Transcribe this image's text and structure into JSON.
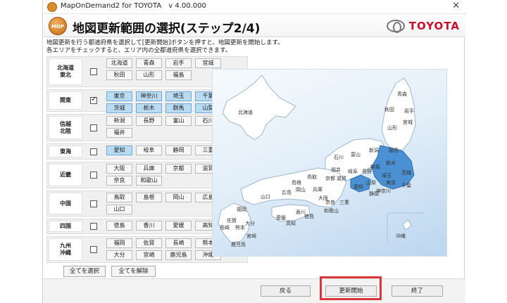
{
  "window": {
    "title": "MapOnDemand2 for TOYOTA",
    "version": "v 4.00.000",
    "close_glyph": "✕"
  },
  "header": {
    "logo_text": "MOP",
    "step_title": "地図更新範囲の選択(ステップ2/4)",
    "brand": "TOYOTA"
  },
  "instructions": {
    "line1": "地図更新を行う都道府県を選択して[更新開始]ボタンを押すと、地図更新を開始します。",
    "line2": "各エリアをチェックすると、エリア内の全都道府県を選択できます。"
  },
  "regions": [
    {
      "label": "北海道\n東北",
      "checked": false,
      "prefs": [
        {
          "name": "北海道",
          "selected": false
        },
        {
          "name": "青森",
          "selected": false
        },
        {
          "name": "岩手",
          "selected": false
        },
        {
          "name": "宮城",
          "selected": false
        },
        {
          "name": "秋田",
          "selected": false
        },
        {
          "name": "山形",
          "selected": false
        },
        {
          "name": "福島",
          "selected": false
        }
      ]
    },
    {
      "label": "関東",
      "checked": true,
      "prefs": [
        {
          "name": "東京",
          "selected": true
        },
        {
          "name": "神奈川",
          "selected": true
        },
        {
          "name": "埼玉",
          "selected": true
        },
        {
          "name": "千葉",
          "selected": true
        },
        {
          "name": "茨城",
          "selected": true
        },
        {
          "name": "栃木",
          "selected": true
        },
        {
          "name": "群馬",
          "selected": true
        },
        {
          "name": "山梨",
          "selected": true
        }
      ]
    },
    {
      "label": "信越\n北陸",
      "checked": false,
      "prefs": [
        {
          "name": "新潟",
          "selected": false
        },
        {
          "name": "長野",
          "selected": false
        },
        {
          "name": "富山",
          "selected": false
        },
        {
          "name": "石川",
          "selected": false
        },
        {
          "name": "福井",
          "selected": false
        }
      ]
    },
    {
      "label": "東海",
      "checked": false,
      "prefs": [
        {
          "name": "愛知",
          "selected": true
        },
        {
          "name": "岐阜",
          "selected": false
        },
        {
          "name": "静岡",
          "selected": false
        },
        {
          "name": "三重",
          "selected": false
        }
      ]
    },
    {
      "label": "近畿",
      "checked": false,
      "prefs": [
        {
          "name": "大阪",
          "selected": false
        },
        {
          "name": "兵庫",
          "selected": false
        },
        {
          "name": "京都",
          "selected": false
        },
        {
          "name": "滋賀",
          "selected": false
        },
        {
          "name": "奈良",
          "selected": false
        },
        {
          "name": "和歌山",
          "selected": false
        }
      ]
    },
    {
      "label": "中国",
      "checked": false,
      "prefs": [
        {
          "name": "鳥取",
          "selected": false
        },
        {
          "name": "島根",
          "selected": false
        },
        {
          "name": "岡山",
          "selected": false
        },
        {
          "name": "広島",
          "selected": false
        },
        {
          "name": "山口",
          "selected": false
        }
      ]
    },
    {
      "label": "四国",
      "checked": false,
      "prefs": [
        {
          "name": "徳島",
          "selected": false
        },
        {
          "name": "香川",
          "selected": false
        },
        {
          "name": "愛媛",
          "selected": false
        },
        {
          "name": "高知",
          "selected": false
        }
      ]
    },
    {
      "label": "九州\n沖縄",
      "checked": false,
      "prefs": [
        {
          "name": "福岡",
          "selected": false
        },
        {
          "name": "佐賀",
          "selected": false
        },
        {
          "name": "長崎",
          "selected": false
        },
        {
          "name": "熊本",
          "selected": false
        },
        {
          "name": "大分",
          "selected": false
        },
        {
          "name": "宮崎",
          "selected": false
        },
        {
          "name": "鹿児島",
          "selected": false
        },
        {
          "name": "沖縄",
          "selected": false
        }
      ]
    }
  ],
  "panel_buttons": {
    "select_all": "全てを選択",
    "clear_all": "全てを解除"
  },
  "map_labels": [
    "北海道",
    "青森",
    "秋田",
    "岩手",
    "山形",
    "宮城",
    "新潟",
    "福島",
    "石川",
    "富山",
    "栃木",
    "群馬",
    "長野",
    "茨城",
    "福井",
    "岐阜",
    "埼玉",
    "東京",
    "千葉",
    "山梨",
    "神奈川",
    "静岡",
    "愛知",
    "滋賀",
    "京都",
    "鳥取",
    "島根",
    "兵庫",
    "岡山",
    "広島",
    "大阪",
    "奈良",
    "三重",
    "和歌山",
    "山口",
    "福岡",
    "香川",
    "徳島",
    "愛媛",
    "高知",
    "佐賀",
    "長崎",
    "大分",
    "熊本",
    "宮崎",
    "鹿児島",
    "沖縄"
  ],
  "colors": {
    "selected_fill": "#b9dcf3",
    "map_selected": "#4a90d2",
    "highlight": "#d9373b"
  },
  "footer": {
    "back": "戻る",
    "start": "更新開始",
    "exit": "終了"
  }
}
